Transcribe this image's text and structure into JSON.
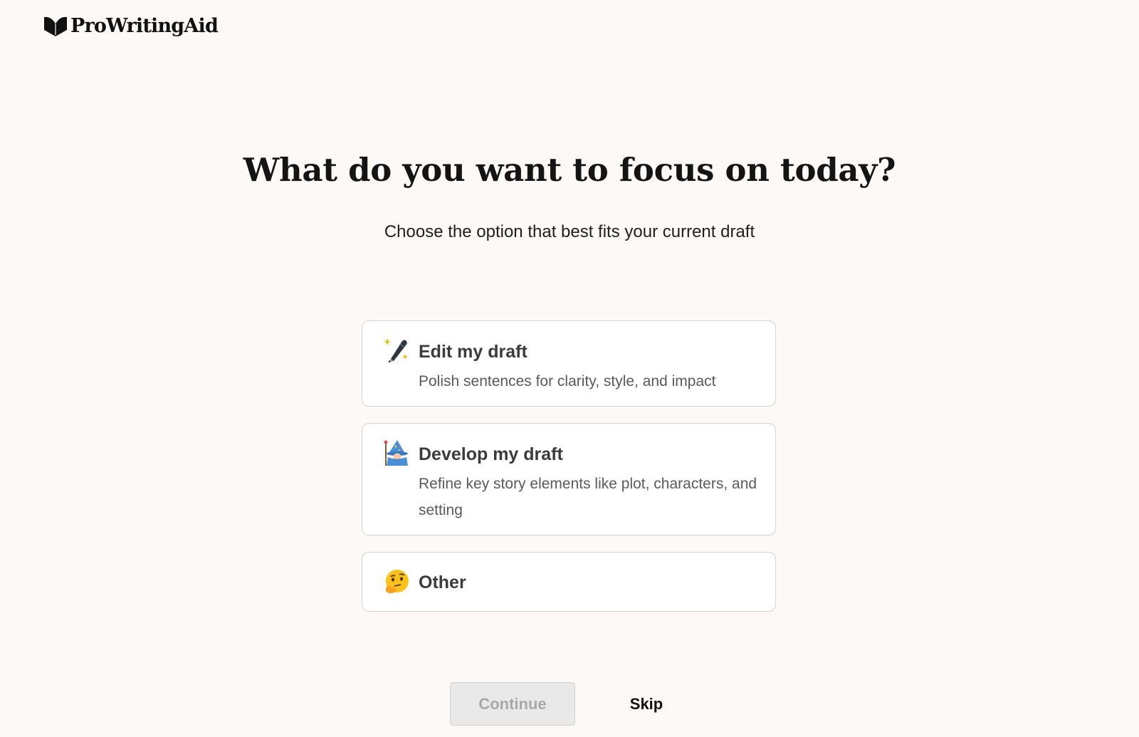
{
  "brand": {
    "name": "ProWritingAid",
    "logo_icon": "book-heart-icon"
  },
  "header": {
    "title": "What do you want to focus on today?",
    "subtitle": "Choose the option that best fits your current draft"
  },
  "options": [
    {
      "icon": "pen-sparkles-icon",
      "title": "Edit my draft",
      "description": "Polish sentences for clarity, style, and impact"
    },
    {
      "icon": "wizard-icon",
      "title": "Develop my draft",
      "description": "Refine key story elements like plot, characters, and setting"
    },
    {
      "icon": "thinking-face-icon",
      "title": "Other"
    }
  ],
  "actions": {
    "continue_label": "Continue",
    "continue_disabled": true,
    "skip_label": "Skip"
  }
}
